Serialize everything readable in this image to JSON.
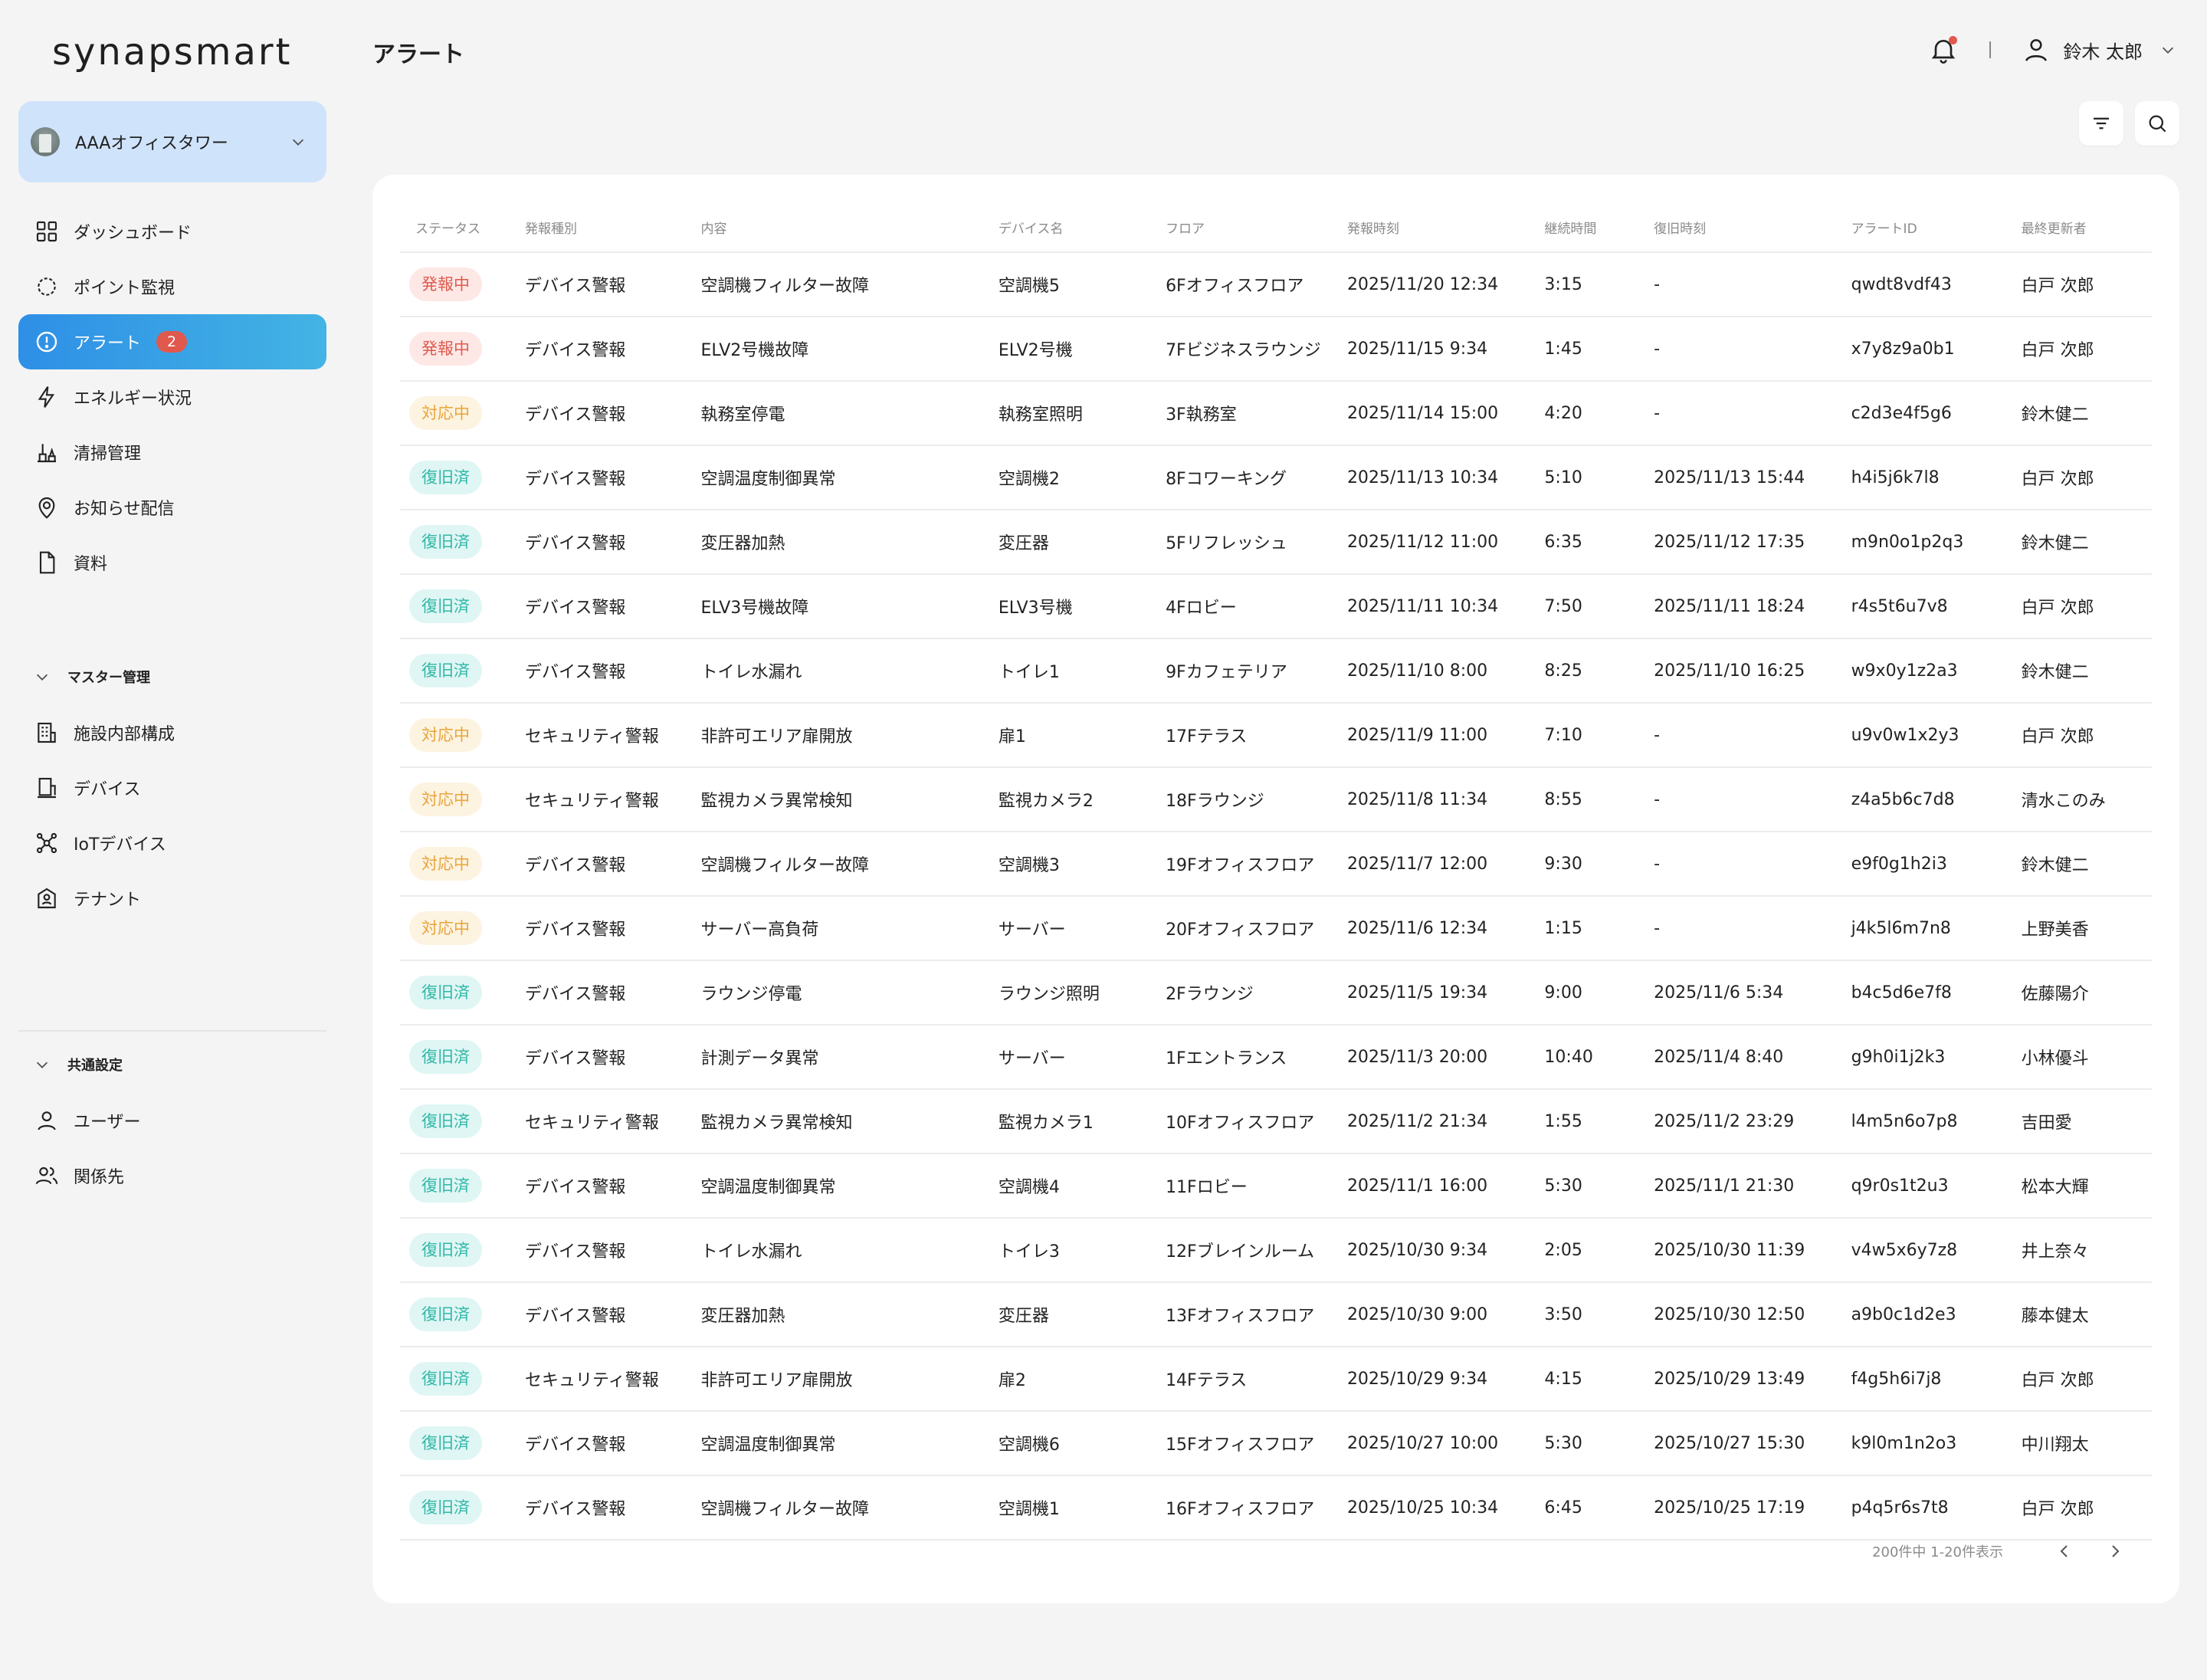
{
  "app": {
    "logo": "synapsmart",
    "page_title": "アラート"
  },
  "facility": {
    "name": "AAAオフィスタワー"
  },
  "nav": {
    "main": [
      {
        "label": "ダッシュボード",
        "icon": "dashboard-icon"
      },
      {
        "label": "ポイント監視",
        "icon": "monitor-icon"
      },
      {
        "label": "アラート",
        "icon": "alert-icon",
        "badge": "2",
        "active": true
      },
      {
        "label": "エネルギー状況",
        "icon": "energy-icon"
      },
      {
        "label": "清掃管理",
        "icon": "cleaning-icon"
      },
      {
        "label": "お知らせ配信",
        "icon": "notice-icon"
      },
      {
        "label": "資料",
        "icon": "document-icon"
      }
    ],
    "master_group": "マスター管理",
    "master": [
      {
        "label": "施設内部構成",
        "icon": "building-icon"
      },
      {
        "label": "デバイス",
        "icon": "device-icon"
      },
      {
        "label": "IoTデバイス",
        "icon": "iot-icon"
      },
      {
        "label": "テナント",
        "icon": "tenant-icon"
      }
    ],
    "common_group": "共通設定",
    "common": [
      {
        "label": "ユーザー",
        "icon": "user-icon"
      },
      {
        "label": "関係先",
        "icon": "partners-icon"
      }
    ]
  },
  "header": {
    "user_name": "鈴木 太郎"
  },
  "table": {
    "columns": [
      "ステータス",
      "発報種別",
      "内容",
      "デバイス名",
      "フロア",
      "発報時刻",
      "継続時間",
      "復旧時刻",
      "アラートID",
      "最終更新者"
    ],
    "rows": [
      [
        "発報中",
        "デバイス警報",
        "空調機フィルター故障",
        "空調機5",
        "6Fオフィスフロア",
        "2025/11/20 12:34",
        "3:15",
        "-",
        "qwdt8vdf43",
        "白戸 次郎"
      ],
      [
        "発報中",
        "デバイス警報",
        "ELV2号機故障",
        "ELV2号機",
        "7Fビジネスラウンジ",
        "2025/11/15 9:34",
        "1:45",
        "-",
        "x7y8z9a0b1",
        "白戸 次郎"
      ],
      [
        "対応中",
        "デバイス警報",
        "執務室停電",
        "執務室照明",
        "3F執務室",
        "2025/11/14 15:00",
        "4:20",
        "-",
        "c2d3e4f5g6",
        "鈴木健二"
      ],
      [
        "復旧済",
        "デバイス警報",
        "空調温度制御異常",
        "空調機2",
        "8Fコワーキング",
        "2025/11/13 10:34",
        "5:10",
        "2025/11/13 15:44",
        "h4i5j6k7l8",
        "白戸 次郎"
      ],
      [
        "復旧済",
        "デバイス警報",
        "変圧器加熱",
        "変圧器",
        "5Fリフレッシュ",
        "2025/11/12 11:00",
        "6:35",
        "2025/11/12 17:35",
        "m9n0o1p2q3",
        "鈴木健二"
      ],
      [
        "復旧済",
        "デバイス警報",
        "ELV3号機故障",
        "ELV3号機",
        "4Fロビー",
        "2025/11/11 10:34",
        "7:50",
        "2025/11/11 18:24",
        "r4s5t6u7v8",
        "白戸 次郎"
      ],
      [
        "復旧済",
        "デバイス警報",
        "トイレ水漏れ",
        "トイレ1",
        "9Fカフェテリア",
        "2025/11/10 8:00",
        "8:25",
        "2025/11/10 16:25",
        "w9x0y1z2a3",
        "鈴木健二"
      ],
      [
        "対応中",
        "セキュリティ警報",
        "非許可エリア扉開放",
        "扉1",
        "17Fテラス",
        "2025/11/9 11:00",
        "7:10",
        "-",
        "u9v0w1x2y3",
        "白戸 次郎"
      ],
      [
        "対応中",
        "セキュリティ警報",
        "監視カメラ異常検知",
        "監視カメラ2",
        "18Fラウンジ",
        "2025/11/8 11:34",
        "8:55",
        "-",
        "z4a5b6c7d8",
        "清水このみ"
      ],
      [
        "対応中",
        "デバイス警報",
        "空調機フィルター故障",
        "空調機3",
        "19Fオフィスフロア",
        "2025/11/7 12:00",
        "9:30",
        "-",
        "e9f0g1h2i3",
        "鈴木健二"
      ],
      [
        "対応中",
        "デバイス警報",
        "サーバー高負荷",
        "サーバー",
        "20Fオフィスフロア",
        "2025/11/6 12:34",
        "1:15",
        "-",
        "j4k5l6m7n8",
        "上野美香"
      ],
      [
        "復旧済",
        "デバイス警報",
        "ラウンジ停電",
        "ラウンジ照明",
        "2Fラウンジ",
        "2025/11/5 19:34",
        "9:00",
        "2025/11/6 5:34",
        "b4c5d6e7f8",
        "佐藤陽介"
      ],
      [
        "復旧済",
        "デバイス警報",
        "計測データ異常",
        "サーバー",
        "1Fエントランス",
        "2025/11/3 20:00",
        "10:40",
        "2025/11/4 8:40",
        "g9h0i1j2k3",
        "小林優斗"
      ],
      [
        "復旧済",
        "セキュリティ警報",
        "監視カメラ異常検知",
        "監視カメラ1",
        "10Fオフィスフロア",
        "2025/11/2 21:34",
        "1:55",
        "2025/11/2 23:29",
        "l4m5n6o7p8",
        "吉田愛"
      ],
      [
        "復旧済",
        "デバイス警報",
        "空調温度制御異常",
        "空調機4",
        "11Fロビー",
        "2025/11/1 16:00",
        "5:30",
        "2025/11/1 21:30",
        "q9r0s1t2u3",
        "松本大輝"
      ],
      [
        "復旧済",
        "デバイス警報",
        "トイレ水漏れ",
        "トイレ3",
        "12Fブレインルーム",
        "2025/10/30 9:34",
        "2:05",
        "2025/10/30 11:39",
        "v4w5x6y7z8",
        "井上奈々"
      ],
      [
        "復旧済",
        "デバイス警報",
        "変圧器加熱",
        "変圧器",
        "13Fオフィスフロア",
        "2025/10/30 9:00",
        "3:50",
        "2025/10/30 12:50",
        "a9b0c1d2e3",
        "藤本健太"
      ],
      [
        "復旧済",
        "セキュリティ警報",
        "非許可エリア扉開放",
        "扉2",
        "14Fテラス",
        "2025/10/29 9:34",
        "4:15",
        "2025/10/29 13:49",
        "f4g5h6i7j8",
        "白戸 次郎"
      ],
      [
        "復旧済",
        "デバイス警報",
        "空調温度制御異常",
        "空調機6",
        "15Fオフィスフロア",
        "2025/10/27 10:00",
        "5:30",
        "2025/10/27 15:30",
        "k9l0m1n2o3",
        "中川翔太"
      ],
      [
        "復旧済",
        "デバイス警報",
        "空調機フィルター故障",
        "空調機1",
        "16Fオフィスフロア",
        "2025/10/25 10:34",
        "6:45",
        "2025/10/25 17:19",
        "p4q5r6s7t8",
        "白戸 次郎"
      ]
    ]
  },
  "pagination": {
    "info": "200件中 1-20件表示"
  },
  "status_colors": {
    "発報中": "#e05a4e",
    "対応中": "#e8a53a",
    "復旧済": "#2fb7a6"
  }
}
